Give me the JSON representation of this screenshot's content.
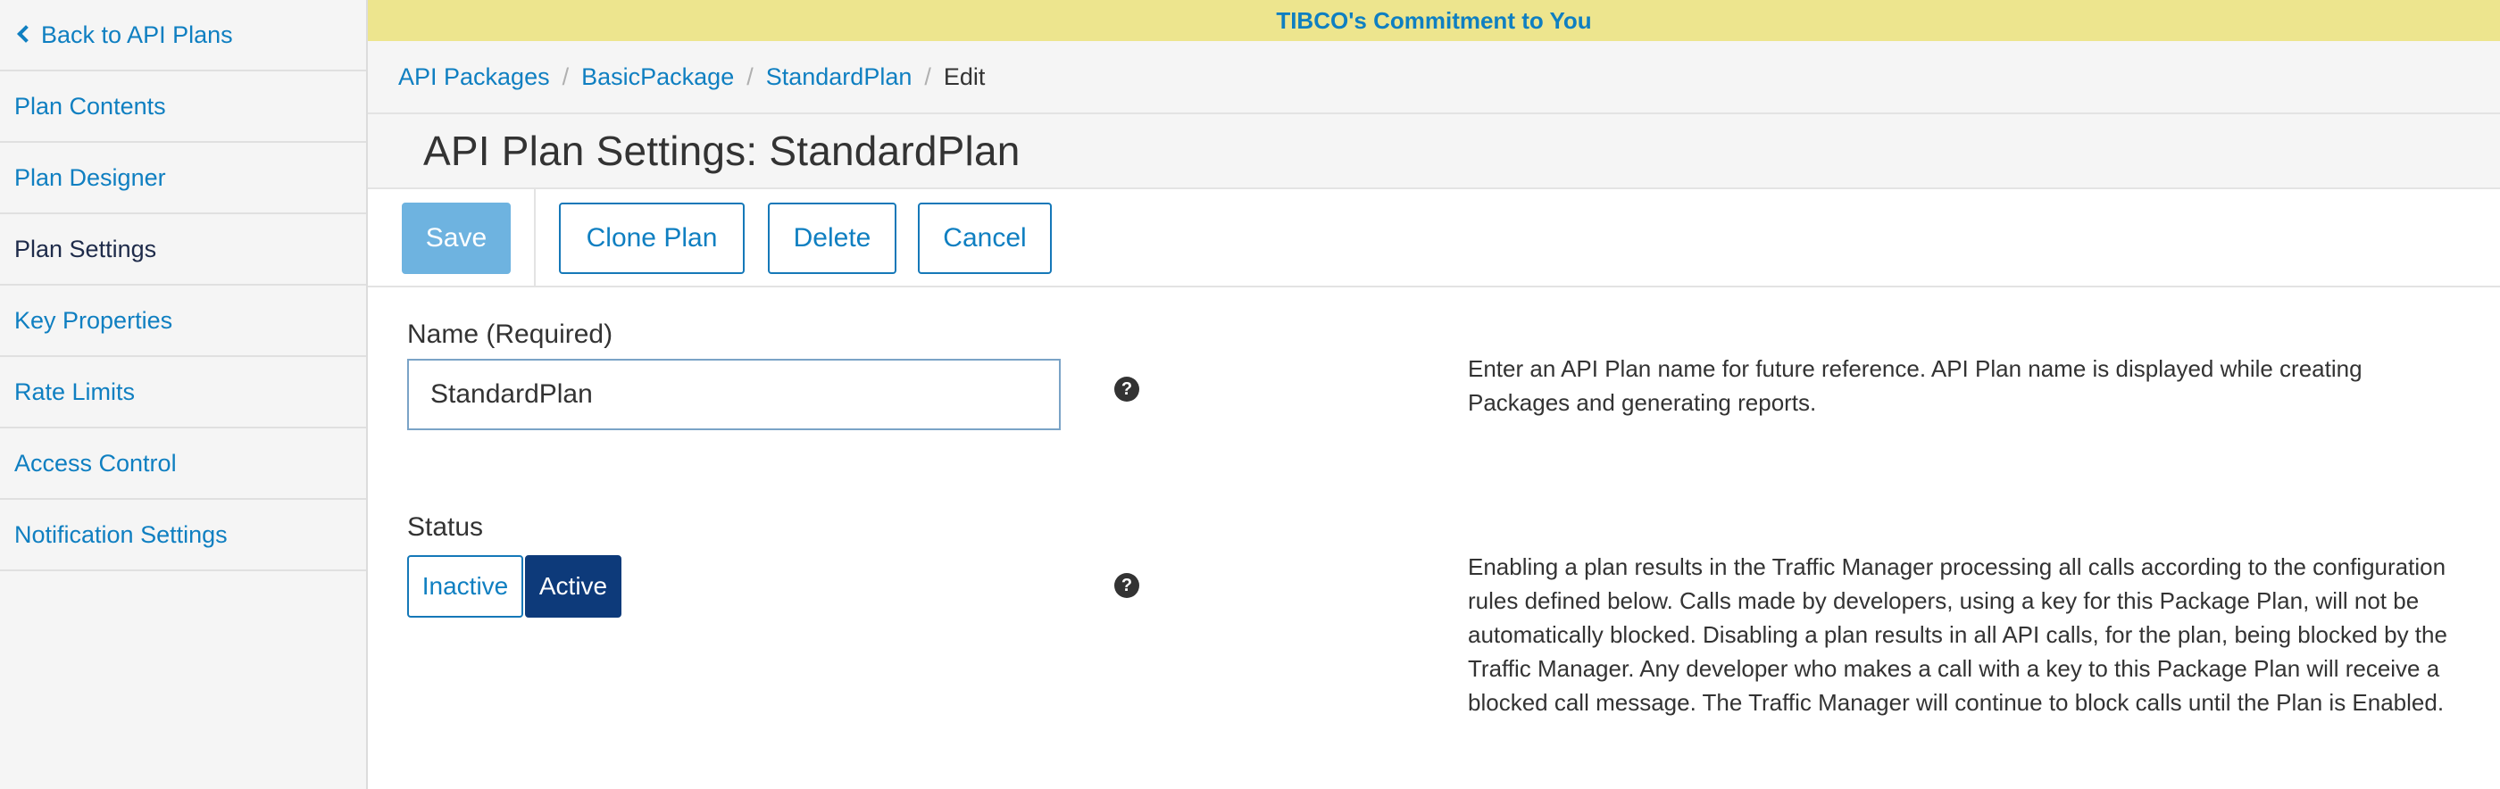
{
  "sidebar": {
    "back_label": "Back to API Plans",
    "items": [
      {
        "label": "Plan Contents"
      },
      {
        "label": "Plan Designer"
      },
      {
        "label": "Plan Settings"
      },
      {
        "label": "Key Properties"
      },
      {
        "label": "Rate Limits"
      },
      {
        "label": "Access Control"
      },
      {
        "label": "Notification Settings"
      }
    ],
    "active_item": "Plan Settings"
  },
  "banner": {
    "text": "TIBCO's Commitment to You"
  },
  "breadcrumb": {
    "items": [
      "API Packages",
      "BasicPackage",
      "StandardPlan"
    ],
    "current": "Edit"
  },
  "page": {
    "title": "API Plan Settings: StandardPlan"
  },
  "toolbar": {
    "save_label": "Save",
    "clone_label": "Clone Plan",
    "delete_label": "Delete",
    "cancel_label": "Cancel"
  },
  "form": {
    "name": {
      "label": "Name (Required)",
      "value": "StandardPlan",
      "help_icon": "question-circle-icon",
      "help_text": "Enter an API Plan name for future reference. API Plan name is displayed while creating Packages and generating reports."
    },
    "status": {
      "label": "Status",
      "options": [
        "Inactive",
        "Active"
      ],
      "selected": "Active",
      "help_icon": "question-circle-icon",
      "help_text": "Enabling a plan results in the Traffic Manager processing all calls according to the configuration rules defined below. Calls made by developers, using a key for this Package Plan, will not be automatically blocked. Disabling a plan results in all API calls, for the plan, being blocked by the Traffic Manager. Any developer who makes a call with a key to this Package Plan will receive a blocked call message. The Traffic Manager will continue to block calls until the Plan is Enabled."
    }
  },
  "colors": {
    "link": "#0f7fc1",
    "banner_bg": "#ede58e",
    "save_bg": "#6eb3e0",
    "active_status_bg": "#0d3a7a",
    "sidebar_bg": "#f5f5f5"
  }
}
